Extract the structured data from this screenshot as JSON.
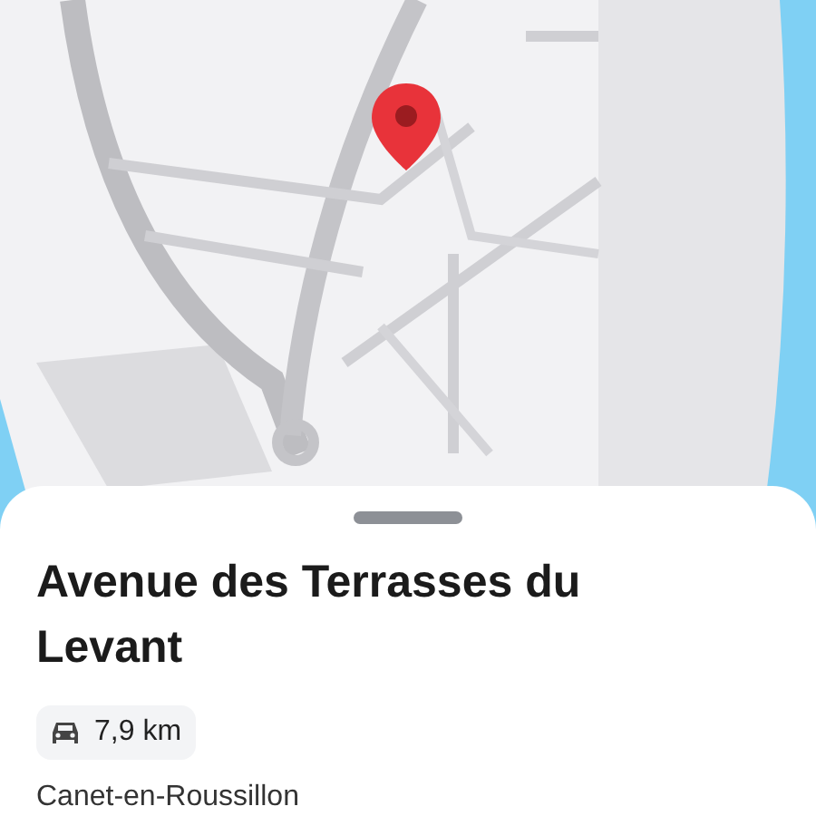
{
  "sheet": {
    "title": "Avenue des Terrasses du Levant",
    "distance": {
      "kind": "car",
      "text": "7,9 km"
    },
    "locality": "Canet-en-Roussillon"
  }
}
